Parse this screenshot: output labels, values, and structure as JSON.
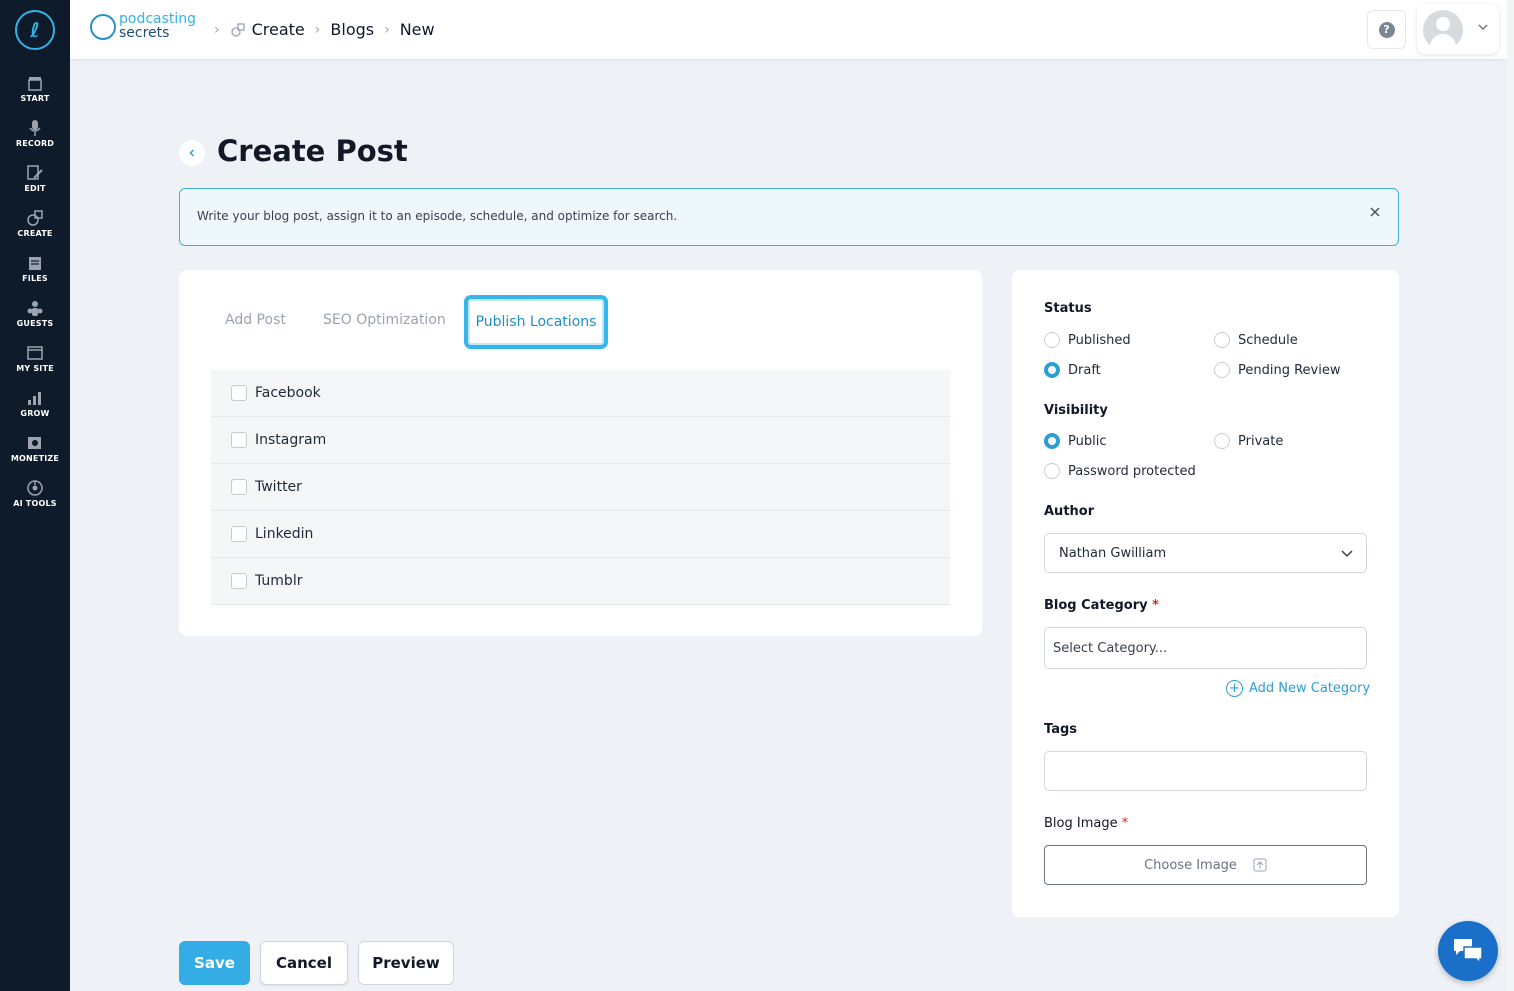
{
  "brand": {
    "line1": "podcasting",
    "line2": "secrets"
  },
  "sidebar": {
    "items": [
      {
        "label": "START",
        "icon": "film-slate-icon"
      },
      {
        "label": "RECORD",
        "icon": "microphone-icon"
      },
      {
        "label": "EDIT",
        "icon": "edit-icon"
      },
      {
        "label": "CREATE",
        "icon": "create-icon"
      },
      {
        "label": "FILES",
        "icon": "files-icon"
      },
      {
        "label": "GUESTS",
        "icon": "guests-icon"
      },
      {
        "label": "MY SITE",
        "icon": "browser-icon"
      },
      {
        "label": "GROW",
        "icon": "bar-chart-icon"
      },
      {
        "label": "MONETIZE",
        "icon": "monetize-icon"
      },
      {
        "label": "AI TOOLS",
        "icon": "ai-tools-icon"
      }
    ]
  },
  "breadcrumb": {
    "create": "Create",
    "blogs": "Blogs",
    "new": "New"
  },
  "page": {
    "title": "Create Post"
  },
  "banner": {
    "text": "Write your blog post, assign it to an episode, schedule, and optimize for search."
  },
  "tabs": {
    "add_post": "Add Post",
    "seo": "SEO Optimization",
    "publish": "Publish Locations"
  },
  "locations": [
    "Facebook",
    "Instagram",
    "Twitter",
    "Linkedin",
    "Tumblr"
  ],
  "status": {
    "label": "Status",
    "options": {
      "published": "Published",
      "schedule": "Schedule",
      "draft": "Draft",
      "pending": "Pending Review"
    },
    "selected": "Draft"
  },
  "visibility": {
    "label": "Visibility",
    "options": {
      "public": "Public",
      "private": "Private",
      "password": "Password protected"
    },
    "selected": "Public"
  },
  "author": {
    "label": "Author",
    "value": "Nathan Gwilliam"
  },
  "category": {
    "label": "Blog Category",
    "required_mark": "*",
    "placeholder": "Select Category...",
    "add_label": "Add New Category"
  },
  "tags": {
    "label": "Tags",
    "value": ""
  },
  "image": {
    "label": "Blog Image",
    "required_mark": "*",
    "button": "Choose Image"
  },
  "actions": {
    "save": "Save",
    "cancel": "Cancel",
    "preview": "Preview"
  },
  "colors": {
    "accent": "#34b3e6",
    "sidebar": "#0d1b2a",
    "save_button": "#34ade6",
    "chat": "#1a6fc9"
  }
}
